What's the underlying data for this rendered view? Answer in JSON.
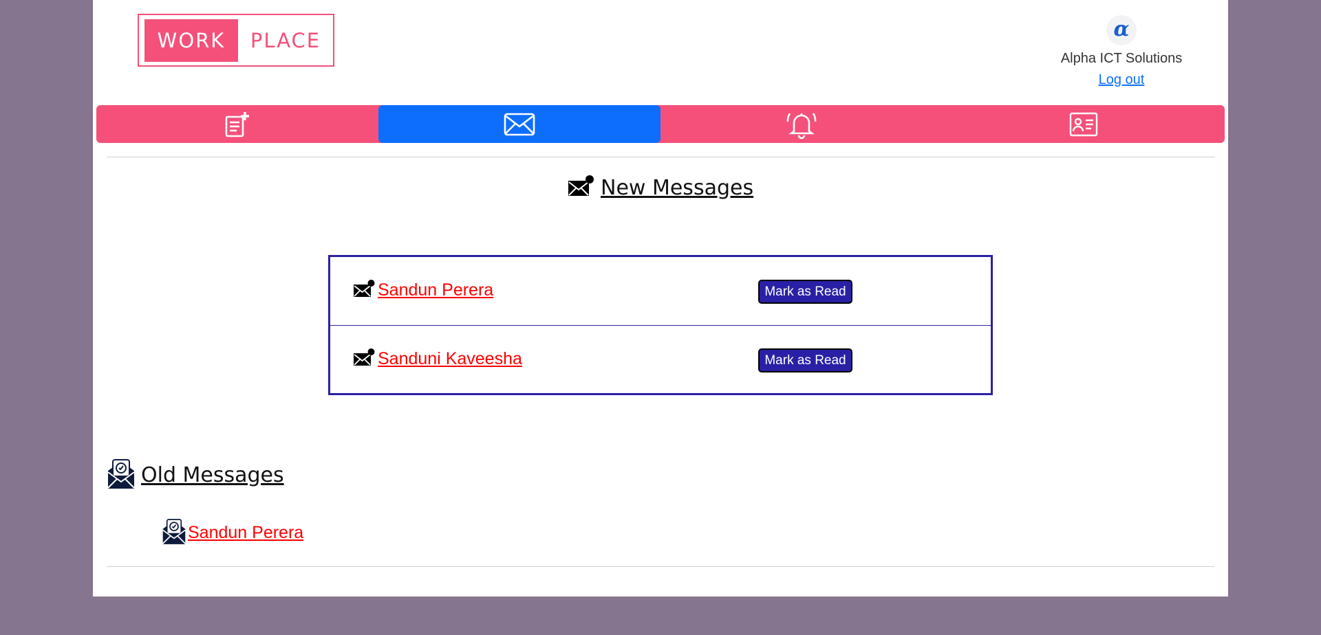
{
  "header": {
    "logo": {
      "left": "WORK",
      "right": "PLACE"
    },
    "company": {
      "logo_glyph": "α",
      "name": "Alpha ICT Solutions",
      "logout_label": "Log out"
    }
  },
  "nav": {
    "items": [
      {
        "icon": "add-post-icon",
        "active": false
      },
      {
        "icon": "envelope-icon",
        "active": true
      },
      {
        "icon": "bell-icon",
        "active": false
      },
      {
        "icon": "contact-card-icon",
        "active": false
      }
    ]
  },
  "new_messages": {
    "title": "New Messages",
    "icon": "new-mail-icon",
    "items": [
      {
        "sender": "Sandun Perera",
        "button_label": "Mark as Read"
      },
      {
        "sender": "Sanduni Kaveesha",
        "button_label": "Mark as Read"
      }
    ]
  },
  "old_messages": {
    "title": "Old Messages",
    "icon": "read-mail-icon",
    "items": [
      {
        "sender": "Sandun Perera"
      }
    ]
  },
  "colors": {
    "background": "#86758f",
    "brand_pink": "#f4507a",
    "active_blue": "#0d6efd",
    "button_indigo": "#2a20a6",
    "link_red": "#ff0000"
  }
}
